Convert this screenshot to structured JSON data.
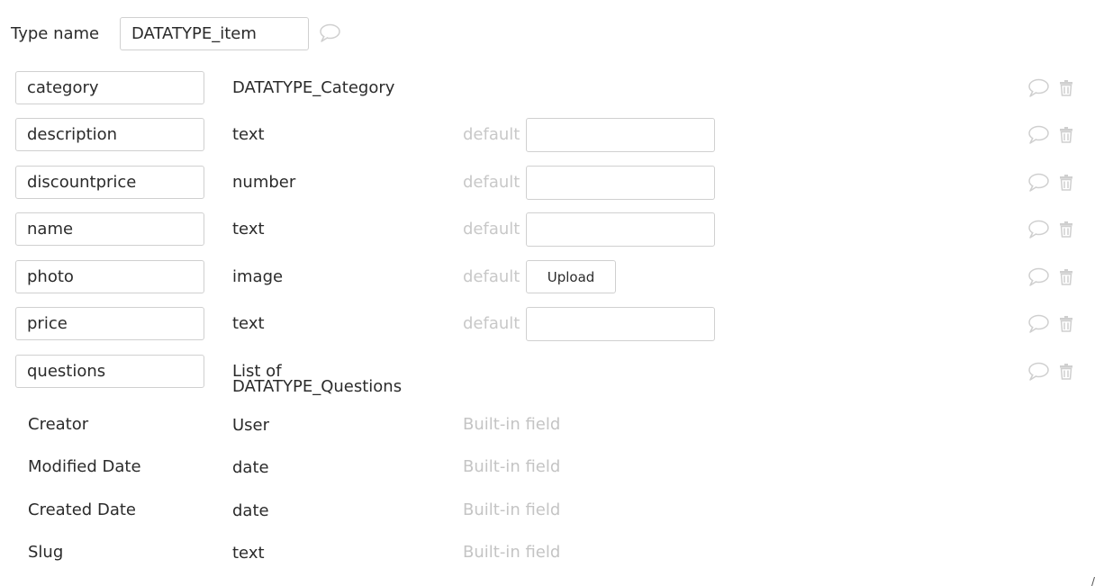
{
  "header": {
    "type_name_label": "Type name",
    "type_name_value": "DATATYPE_item",
    "comment_icon": "speech-bubble-icon"
  },
  "labels": {
    "default": "default",
    "builtin": "Built-in field",
    "upload": "Upload"
  },
  "fields": [
    {
      "name": "category",
      "type": "DATATYPE_Category",
      "has_default": false,
      "default_kind": "none"
    },
    {
      "name": "description",
      "type": "text",
      "has_default": true,
      "default_kind": "text-input",
      "default_value": ""
    },
    {
      "name": "discountprice",
      "type": "number",
      "has_default": true,
      "default_kind": "text-input",
      "default_value": ""
    },
    {
      "name": "name",
      "type": "text",
      "has_default": true,
      "default_kind": "text-input",
      "default_value": ""
    },
    {
      "name": "photo",
      "type": "image",
      "has_default": true,
      "default_kind": "upload-button"
    },
    {
      "name": "price",
      "type": "text",
      "has_default": true,
      "default_kind": "text-input",
      "default_value": ""
    },
    {
      "name": "questions",
      "type_line1": "List of",
      "type_line2": "DATATYPE_Questions",
      "has_default": false,
      "default_kind": "none"
    }
  ],
  "builtin_fields": [
    {
      "name": "Creator",
      "type": "User"
    },
    {
      "name": "Modified Date",
      "type": "date"
    },
    {
      "name": "Created Date",
      "type": "date"
    },
    {
      "name": "Slug",
      "type": "text"
    }
  ],
  "icons": {
    "comment": "speech-bubble-icon",
    "delete": "trash-icon"
  },
  "colors": {
    "text": "#2b2b2b",
    "muted": "#c8c8c8",
    "border": "#d0d0d0",
    "icon": "#cfcfcf"
  }
}
